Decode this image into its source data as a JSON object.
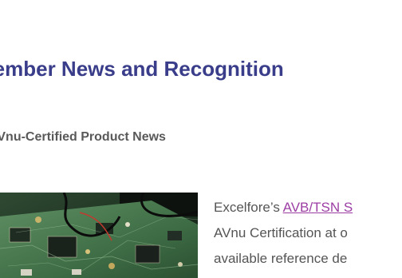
{
  "section": {
    "title": "Member News and Recognition",
    "subtitle": "AVnu-Certified Product News"
  },
  "article": {
    "image_description": "circuit-board-photo",
    "line1_prefix": "Excelfore’s ",
    "line1_link": "AVB/TSN S",
    "line2": "AVnu Certification at o",
    "line3": "available reference de"
  },
  "colors": {
    "heading": "#3a3d8a",
    "subheading": "#595959",
    "body": "#555555",
    "link": "#9c3ea4"
  }
}
